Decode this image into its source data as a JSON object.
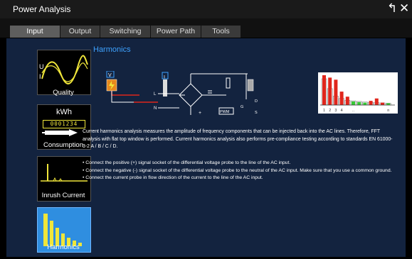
{
  "window": {
    "title": "Power Analysis"
  },
  "tabs": [
    {
      "label": "Input"
    },
    {
      "label": "Output"
    },
    {
      "label": "Switching"
    },
    {
      "label": "Power Path"
    },
    {
      "label": "Tools"
    }
  ],
  "measurements": [
    {
      "label": "Quality"
    },
    {
      "label": "Consumption",
      "readout": "0001234"
    },
    {
      "label": "Inrush Current"
    },
    {
      "label": "Harmonics",
      "selected": true
    }
  ],
  "kwh_label": "kWh",
  "content": {
    "heading": "Harmonics",
    "description": "Current harmonics analysis measures the amplitude of frequency components that can be injected back into the AC lines. Therefore, FFT analysis with flat top window is performed. Current harmonics analysis also performs pre-compliance testing according to standards EN 61000-3-2 A / B / C / D.",
    "bullets": [
      "• Connect the positive (+) signal socket of the differential voltage probe to the line of the AC input.",
      "• Connect the negative (-) signal socket of the differential voltage probe to the neutral of the AC input. Make sure that you use a common ground.",
      "• Connect the current probe in flow direction of the current to the line of the AC input."
    ]
  },
  "diagram": {
    "labels": {
      "v": "V",
      "i": "I",
      "l": "L",
      "n": "N",
      "e": "E",
      "pwm": "PWM",
      "d": "D",
      "g": "G",
      "s": "S",
      "plus": "+",
      "u": "U",
      "i_curve": "I"
    }
  },
  "fft": {
    "axis_labels": [
      "1",
      "2",
      "3",
      "4",
      "..",
      "n"
    ],
    "values": [
      1.0,
      0.92,
      0.85,
      0.45,
      0.28,
      0.12,
      0.1,
      0.08,
      0.14,
      0.22,
      0.08,
      0.06
    ],
    "limits": [
      0.88,
      0.55,
      0.3,
      0.22,
      0.16,
      0.14,
      0.12,
      0.1,
      0.09,
      0.08,
      0.07,
      0.06
    ],
    "colors": {
      "pass": "#36c936",
      "fail": "#e0261c"
    }
  },
  "colors": {
    "accent": "#3ea2ff",
    "panel": "#13233f",
    "selected": "#2f8ee0"
  }
}
